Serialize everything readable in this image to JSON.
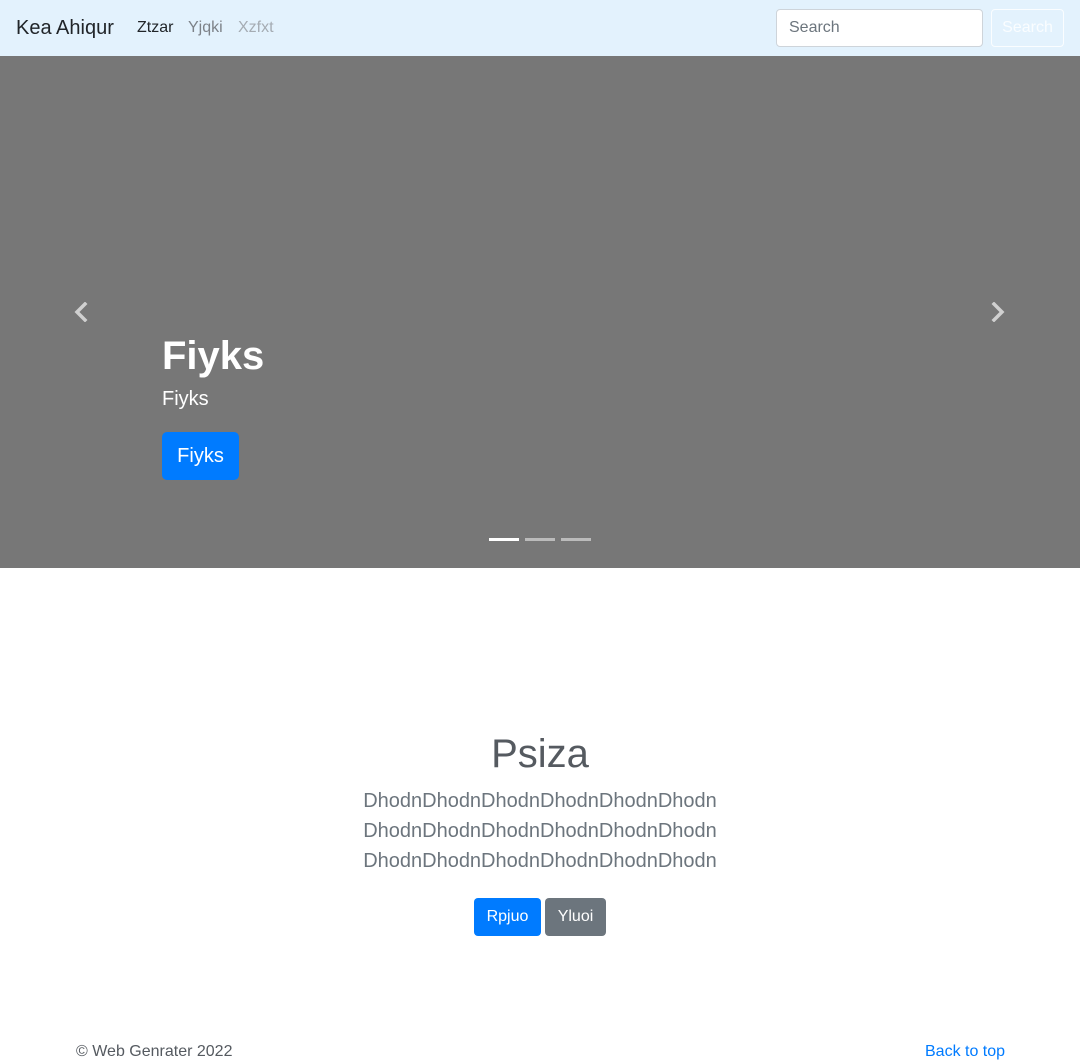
{
  "navbar": {
    "brand": "Kea Ahiqur",
    "links": [
      {
        "label": "Ztzar",
        "state": "active"
      },
      {
        "label": "Yjqki",
        "state": "inactive"
      },
      {
        "label": "Xzfxt",
        "state": "disabled"
      }
    ],
    "search": {
      "placeholder": "Search",
      "value": "",
      "button_label": "Search"
    },
    "background_color": "#e3f2fd"
  },
  "carousel": {
    "background_color": "#777777",
    "prev_icon": "chevron-left-icon",
    "next_icon": "chevron-right-icon",
    "slide": {
      "title": "Fiyks",
      "text": "Fiyks",
      "button_label": "Fiyks"
    },
    "indicator_count": 3,
    "active_indicator": 0
  },
  "section": {
    "heading": "Psiza",
    "lines": [
      "DhodnDhodnDhodnDhodnDhodnDhodn",
      "DhodnDhodnDhodnDhodnDhodnDhodn",
      "DhodnDhodnDhodnDhodnDhodnDhodn"
    ],
    "primary_button": "Rpjuo",
    "secondary_button": "Yluoi"
  },
  "footer": {
    "copyright": "© Web Genrater 2022",
    "back_to_top": "Back to top"
  },
  "colors": {
    "primary": "#007bff",
    "secondary": "#6c757d"
  }
}
